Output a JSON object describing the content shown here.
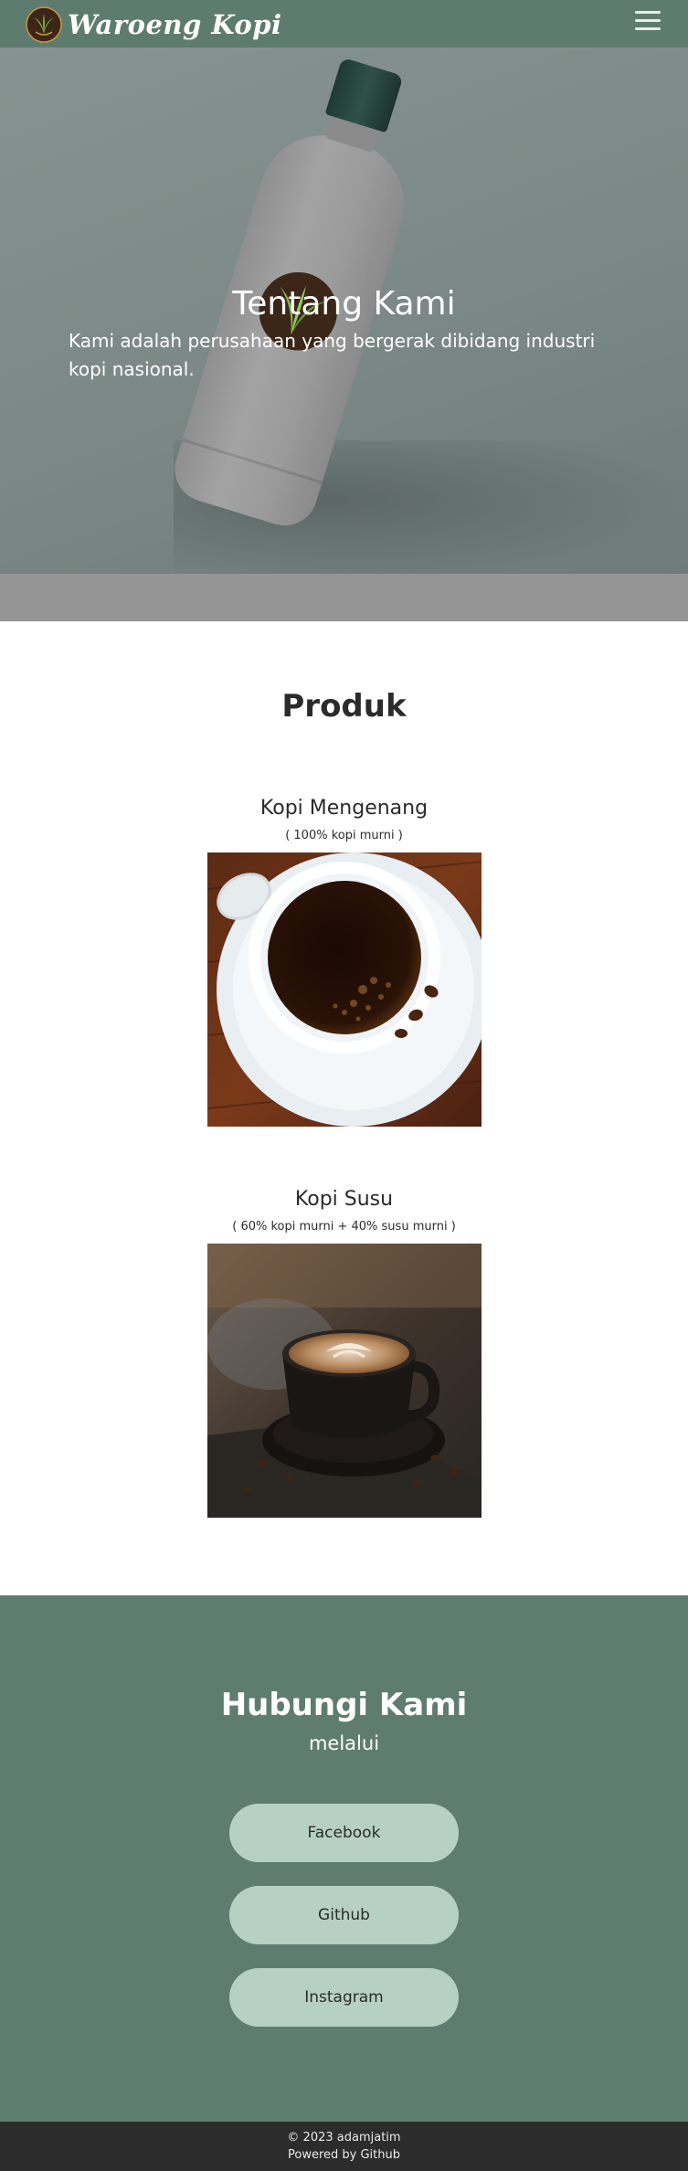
{
  "navbar": {
    "brand_name": "Waroeng Kopi",
    "logo_icon": "bamboo-leaf-logo-icon",
    "menu_icon": "hamburger-menu-icon"
  },
  "hero": {
    "title": "Tentang Kami",
    "text": "Kami adalah perusahaan yang bergerak dibidang industri kopi nasional."
  },
  "produk": {
    "title": "Produk",
    "items": [
      {
        "name": "Kopi Mengenang",
        "description": "( 100% kopi murni )"
      },
      {
        "name": "Kopi Susu",
        "description": "( 60% kopi murni + 40% susu murni )"
      }
    ]
  },
  "contact": {
    "title": "Hubungi Kami",
    "subtitle": "melalui",
    "buttons": [
      "Facebook",
      "Github",
      "Instagram"
    ]
  },
  "footer": {
    "copyright": "© 2023 adamjatim",
    "powered": "Powered by Github"
  },
  "colors": {
    "navbar": "#5e7b70",
    "contact_bg": "#5f7c71",
    "button_bg": "#b6d1c4",
    "footer_bg": "#2c2c2c"
  }
}
